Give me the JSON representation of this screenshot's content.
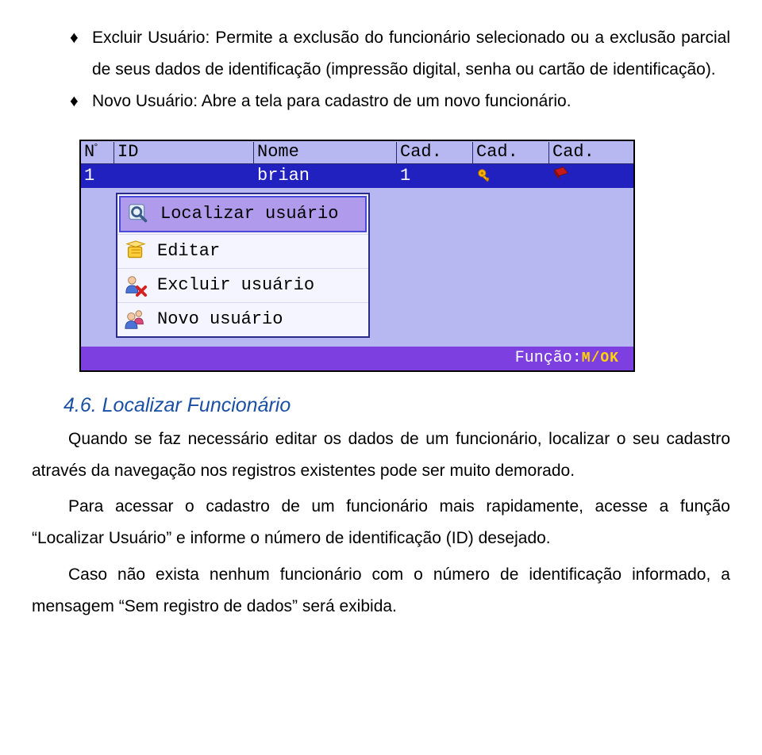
{
  "bullets": {
    "b1_label": "Excluir Usuário:",
    "b1_rest": " Permite a exclusão do funcionário selecionado ou a exclusão parcial de seus dados de identificação (impressão digital, senha ou cartão de identificação).",
    "b2_label": "Novo Usuário:",
    "b2_rest": " Abre a tela para cadastro de um novo funcionário."
  },
  "device": {
    "headers": {
      "n": "N",
      "deg": "°",
      "id": "ID",
      "nome": "Nome",
      "cad": "Cad."
    },
    "row": {
      "n": "1",
      "id": "",
      "nome": "brian",
      "cad1": "1"
    },
    "menu": {
      "localizar": "Localizar usuário",
      "editar": "Editar",
      "excluir": "Excluir usuário",
      "novo": "Novo usuário"
    },
    "footer": {
      "label": "Função:",
      "key": "M/OK"
    }
  },
  "section": {
    "heading": "4.6. Localizar Funcionário",
    "p1": "Quando se faz necessário editar os dados de um funcionário, localizar o seu cadastro através da navegação nos registros existentes pode ser muito demorado.",
    "p2": "Para acessar o cadastro de um funcionário mais rapidamente, acesse a função “Localizar Usuário” e informe o número de identificação (ID) desejado.",
    "p3": "Caso não exista nenhum funcionário com o número de identificação informado, a mensagem “Sem registro de dados” será exibida."
  }
}
